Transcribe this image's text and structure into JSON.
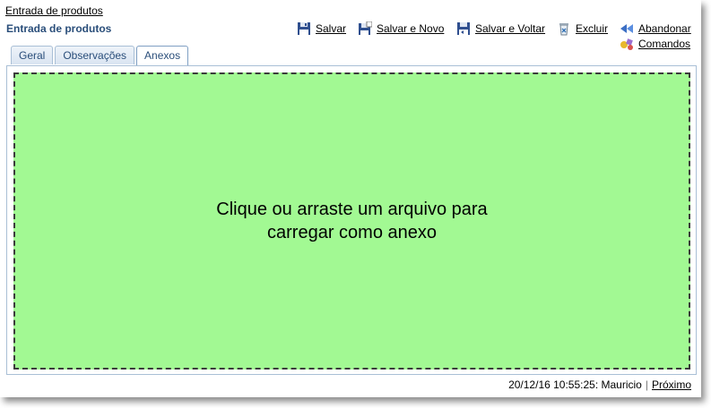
{
  "breadcrumb": "Entrada de produtos",
  "page_title": "Entrada de produtos",
  "toolbar": {
    "salvar": "Salvar",
    "salvar_novo": "Salvar e Novo",
    "salvar_voltar": "Salvar e Voltar",
    "excluir": "Excluir",
    "abandonar": "Abandonar",
    "comandos": "Comandos"
  },
  "tabs": [
    {
      "label": "Geral"
    },
    {
      "label": "Observações"
    },
    {
      "label": "Anexos",
      "active": true
    }
  ],
  "dropzone": {
    "line1": "Clique ou arraste um arquivo para",
    "line2": "carregar como anexo"
  },
  "status": {
    "info": "20/12/16 10:55:25: Mauricio",
    "separator": "|",
    "next": "Próximo"
  },
  "colors": {
    "dropzone_bg": "#a2f993",
    "title_blue": "#2a4e7a",
    "tab_border": "#a9bfd6"
  }
}
